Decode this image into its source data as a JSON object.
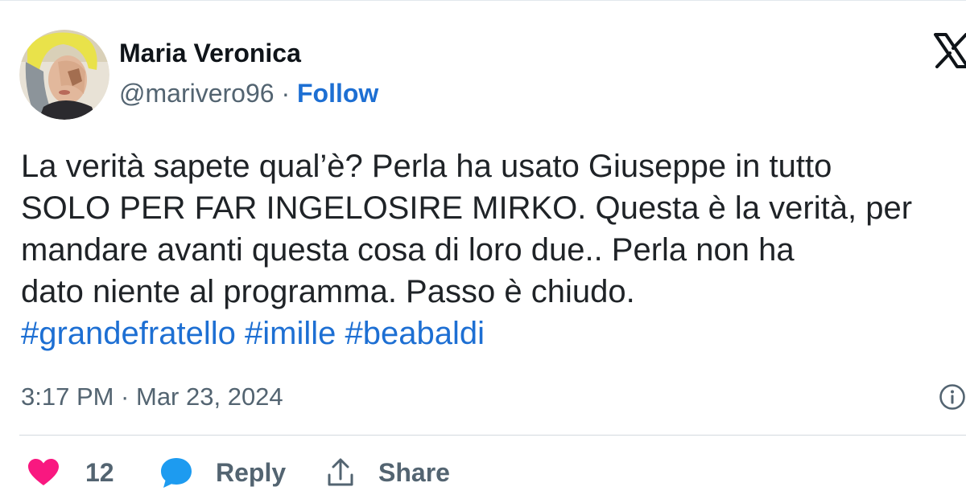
{
  "tweet": {
    "author": {
      "name": "Maria Veronica",
      "handle": "@marivero96",
      "separator": " · ",
      "follow_label": "Follow",
      "avatar_icon": "avatar-photo"
    },
    "brand_icon": "x-logo-icon",
    "text_lines": [
      "La verità sapete qual’è? Perla ha usato Giuseppe in tutto",
      "SOLO PER FAR INGELOSIRE MIRKO. Questa è la verità, per",
      "mandare avanti questa cosa di loro due.. Perla non ha",
      "dato niente al programma. Passo è chiudo."
    ],
    "hashtags": [
      "#grandefratello",
      "#imille",
      "#beabaldi"
    ],
    "timestamp": "3:17 PM · Mar 23, 2024",
    "info_icon": "info-icon",
    "actions": {
      "like_count": "12",
      "reply_label": "Reply",
      "share_label": "Share"
    },
    "colors": {
      "accent": "#1d6fd3",
      "heart": "#f91880",
      "reply_bubble": "#1d9bf0",
      "muted_text": "#536471"
    }
  }
}
